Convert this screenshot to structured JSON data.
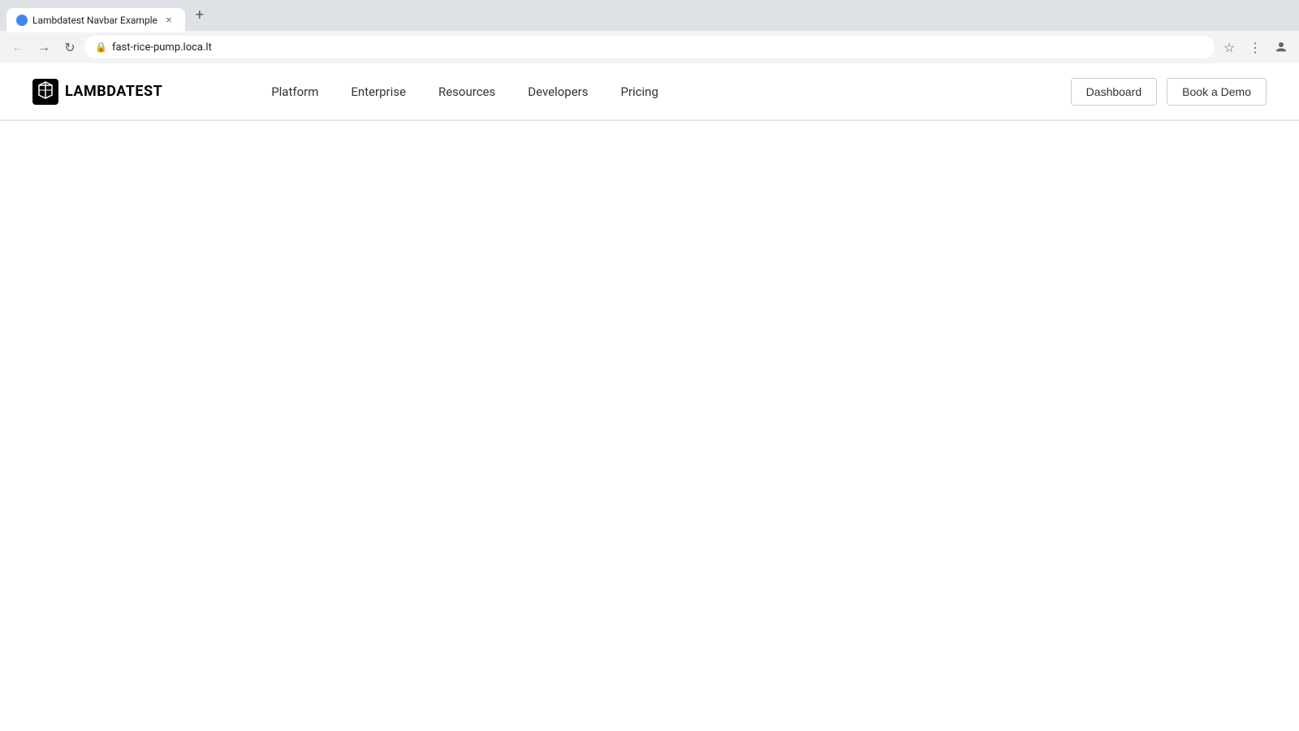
{
  "browser": {
    "tab": {
      "title": "Lambdatest Navbar Example",
      "favicon_color": "#4285f4"
    },
    "address_bar": {
      "url": "fast-rice-pump.loca.lt",
      "lock_icon": "🔒"
    },
    "new_tab_label": "+"
  },
  "navbar": {
    "logo": {
      "text": "LAMBDATEST"
    },
    "nav_links": [
      {
        "label": "Platform",
        "id": "platform"
      },
      {
        "label": "Enterprise",
        "id": "enterprise"
      },
      {
        "label": "Resources",
        "id": "resources"
      },
      {
        "label": "Developers",
        "id": "developers"
      },
      {
        "label": "Pricing",
        "id": "pricing"
      }
    ],
    "actions": {
      "dashboard_label": "Dashboard",
      "demo_label": "Book a Demo"
    }
  }
}
